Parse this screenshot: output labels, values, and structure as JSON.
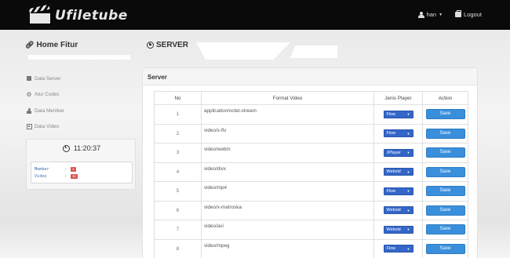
{
  "navbar": {
    "brand": "Ufiletube",
    "user_label": "han",
    "logout_label": "Logout"
  },
  "sidebar": {
    "title": "Home Fitur",
    "items": [
      {
        "label": "Data Server",
        "icon": "server-icon"
      },
      {
        "label": "Atur Codec",
        "icon": "gear-icon"
      },
      {
        "label": "Data Member",
        "icon": "user-icon"
      },
      {
        "label": "Data Video",
        "icon": "film-icon"
      }
    ],
    "clock": "11:20:37",
    "stats": [
      {
        "label": "Member",
        "separator": ":",
        "value": "1"
      },
      {
        "label": "Video",
        "separator": ":",
        "value": "11"
      }
    ]
  },
  "main": {
    "title": "SERVER",
    "panel_title": "Server",
    "columns": [
      "No",
      "Format Video",
      "Jenis Player",
      "Action"
    ],
    "save_label": "Save",
    "rows": [
      {
        "no": "1",
        "format": "application/octet-stream",
        "player": "Flow"
      },
      {
        "no": "2",
        "format": "video/x-flv",
        "player": "Flow"
      },
      {
        "no": "3",
        "format": "video/webm",
        "player": "JPlayer"
      },
      {
        "no": "4",
        "format": "video/divx",
        "player": "Webvid"
      },
      {
        "no": "5",
        "format": "video/mp4",
        "player": "Flow"
      },
      {
        "no": "6",
        "format": "video/x-matroska",
        "player": "Webvid"
      },
      {
        "no": "7",
        "format": "video/avi",
        "player": "Webvid"
      },
      {
        "no": "8",
        "format": "video/mpeg",
        "player": "Flow"
      }
    ]
  },
  "colors": {
    "navbar": "#0a0a0a",
    "select": "#3366c8",
    "save_button": "#3a8fdc",
    "badge": "#d9534f"
  }
}
